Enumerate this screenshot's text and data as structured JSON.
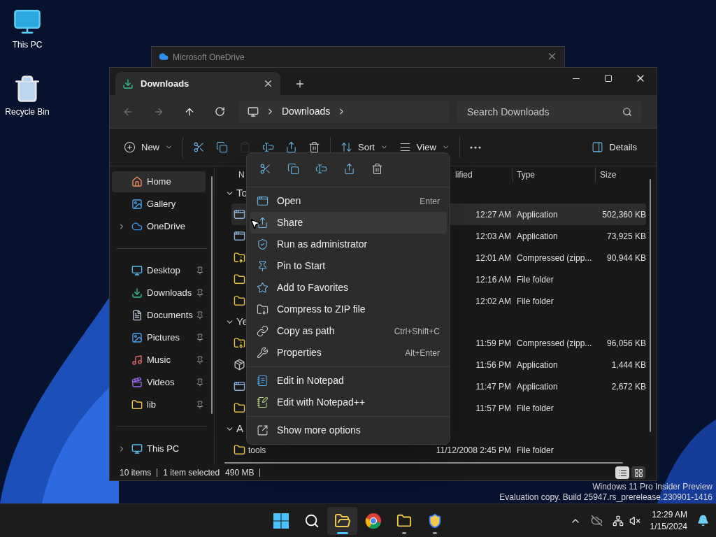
{
  "desktop_icons": [
    {
      "label": "This PC"
    },
    {
      "label": "Recycle Bin"
    }
  ],
  "background_window": {
    "title": "Microsoft OneDrive"
  },
  "explorer": {
    "tab": {
      "title": "Downloads",
      "selected": true
    },
    "breadcrumb": [
      "Downloads"
    ],
    "search": {
      "placeholder": "Search Downloads"
    },
    "toolbar": [
      {
        "kind": "new",
        "label": "New",
        "disabled": false
      },
      {
        "kind": "cut",
        "disabled": false
      },
      {
        "kind": "copy",
        "disabled": false
      },
      {
        "kind": "paste",
        "disabled": true
      },
      {
        "kind": "rename",
        "disabled": false
      },
      {
        "kind": "share",
        "disabled": false
      },
      {
        "kind": "delete",
        "disabled": false
      },
      {
        "kind": "sort",
        "label": "Sort",
        "disabled": false
      },
      {
        "kind": "view",
        "label": "View",
        "disabled": false
      },
      {
        "kind": "more",
        "disabled": false
      },
      {
        "kind": "details",
        "label": "Details",
        "disabled": false
      }
    ],
    "sidebar": {
      "sections": [
        {
          "items": [
            {
              "label": "Home",
              "selected": true,
              "pinned": false
            },
            {
              "label": "Gallery",
              "selected": false,
              "pinned": false
            },
            {
              "label": "OneDrive",
              "selected": false,
              "pinned": false,
              "expanded": false
            }
          ]
        },
        {
          "items": [
            {
              "label": "Desktop",
              "selected": false,
              "pinned": true
            },
            {
              "label": "Downloads",
              "selected": false,
              "pinned": true
            },
            {
              "label": "Documents",
              "selected": false,
              "pinned": true
            },
            {
              "label": "Pictures",
              "selected": false,
              "pinned": true
            },
            {
              "label": "Music",
              "selected": false,
              "pinned": true
            },
            {
              "label": "Videos",
              "selected": false,
              "pinned": true
            },
            {
              "label": "lib",
              "selected": false,
              "pinned": true
            }
          ]
        },
        {
          "items": [
            {
              "label": "This PC",
              "selected": false,
              "pinned": false,
              "expanded": false
            }
          ]
        }
      ]
    },
    "columns": [
      "N",
      "lified",
      "Type",
      "Size"
    ],
    "groups": [
      {
        "label": "To",
        "expanded": true,
        "rows": [
          {
            "kind": "app",
            "modified": "12:27 AM",
            "type": "Application",
            "size": "502,360 KB",
            "selected": true
          },
          {
            "kind": "app",
            "modified": "12:03 AM",
            "type": "Application",
            "size": "73,925 KB",
            "selected": false
          },
          {
            "kind": "zip",
            "modified": "12:01 AM",
            "type": "Compressed (zipp...",
            "size": "90,944 KB",
            "selected": false
          },
          {
            "kind": "folder",
            "modified": "12:16 AM",
            "type": "File folder",
            "size": "",
            "selected": false
          },
          {
            "kind": "folder",
            "modified": "12:02 AM",
            "type": "File folder",
            "size": "",
            "selected": false
          }
        ]
      },
      {
        "label": "Ye",
        "expanded": true,
        "rows": [
          {
            "kind": "zip",
            "modified": "11:59 PM",
            "type": "Compressed (zipp...",
            "size": "96,056 KB",
            "selected": false
          },
          {
            "kind": "setup",
            "modified": "11:56 PM",
            "type": "Application",
            "size": "1,444 KB",
            "selected": false
          },
          {
            "kind": "app",
            "modified": "11:47 PM",
            "type": "Application",
            "size": "2,672 KB",
            "selected": false
          },
          {
            "kind": "folder",
            "modified": "11:57 PM",
            "type": "File folder",
            "size": "",
            "selected": false
          }
        ]
      },
      {
        "label": "A",
        "expanded": true,
        "rows": [
          {
            "kind": "folder",
            "name": "tools",
            "modified": "11/12/2008 2:45 PM",
            "type": "File folder",
            "size": "",
            "selected": false
          }
        ]
      }
    ],
    "status": {
      "count": "10 items",
      "selection": "1 item selected",
      "size": "490 MB"
    },
    "view_modes": [
      {
        "kind": "details",
        "selected": true
      },
      {
        "kind": "tiles",
        "selected": false
      }
    ]
  },
  "context_menu": {
    "sections": [
      [
        {
          "kind": "open",
          "label": "Open",
          "shortcut": "Enter",
          "selected": false
        },
        {
          "kind": "share",
          "label": "Share",
          "selected": true
        },
        {
          "kind": "admin",
          "label": "Run as administrator",
          "selected": false
        },
        {
          "kind": "pin",
          "label": "Pin to Start",
          "selected": false
        },
        {
          "kind": "favorite",
          "label": "Add to Favorites",
          "selected": false
        },
        {
          "kind": "zip",
          "label": "Compress to ZIP file",
          "selected": false
        },
        {
          "kind": "path",
          "label": "Copy as path",
          "shortcut": "Ctrl+Shift+C",
          "selected": false
        },
        {
          "kind": "properties",
          "label": "Properties",
          "shortcut": "Alt+Enter",
          "selected": false
        }
      ],
      [
        {
          "kind": "notepad",
          "label": "Edit in Notepad",
          "selected": false
        },
        {
          "kind": "notepadpp",
          "label": "Edit with Notepad++",
          "selected": false
        }
      ],
      [
        {
          "kind": "more",
          "label": "Show more options",
          "selected": false
        }
      ]
    ]
  },
  "watermark": [
    "Windows 11 Pro Insider Preview",
    "Evaluation copy. Build 25947.rs_prerelease.230901-1416"
  ],
  "taskbar": {
    "apps": [
      {
        "kind": "start",
        "active": false,
        "running": false
      },
      {
        "kind": "search",
        "active": false,
        "running": false
      },
      {
        "kind": "explorer",
        "active": true,
        "running": true
      },
      {
        "kind": "chrome",
        "active": false,
        "running": false
      },
      {
        "kind": "folder",
        "active": false,
        "running": true
      },
      {
        "kind": "shield",
        "active": false,
        "running": true
      }
    ],
    "time": "12:29 AM",
    "date": "1/15/2024"
  }
}
